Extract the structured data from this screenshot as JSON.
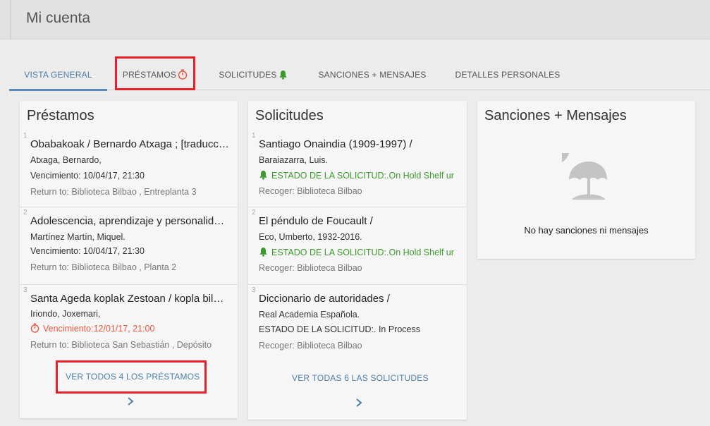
{
  "header": {
    "title": "Mi cuenta"
  },
  "tabs": [
    {
      "label": "VISTA GENERAL"
    },
    {
      "label": "PRÉSTAMOS"
    },
    {
      "label": "SOLICITUDES"
    },
    {
      "label": "SANCIONES + MENSAJES"
    },
    {
      "label": "DETALLES PERSONALES"
    }
  ],
  "loans": {
    "title": "Préstamos",
    "items": [
      {
        "num": "1",
        "title": "Obabakoak / Bernardo Atxaga ; [traducción...",
        "author": "Atxaga, Bernardo,",
        "due": "Vencimiento: 10/04/17, 21:30",
        "return_to": "Return to: Biblioteca Bilbao , Entreplanta 3"
      },
      {
        "num": "2",
        "title": "Adolescencia, aprendizaje y personalidad...",
        "author": "Martínez Martín, Miquel.",
        "due": "Vencimiento: 10/04/17, 21:30",
        "return_to": "Return to: Biblioteca Bilbao , Planta 2"
      },
      {
        "num": "3",
        "title": "Santa Ageda koplak Zestoan / kopla bildumak...",
        "author": "Iriondo, Joxemari,",
        "due": "Vencimiento:12/01/17, 21:00",
        "return_to": "Return to: Biblioteca San Sebastián , Depósito"
      }
    ],
    "see_all": "VER TODOS 4 LOS PRÉSTAMOS"
  },
  "requests": {
    "title": "Solicitudes",
    "items": [
      {
        "num": "1",
        "title": "Santiago Onaindia (1909-1997) /",
        "author": "Baraiazarra, Luis.",
        "status": "ESTADO DE LA SOLICITUD:.On Hold Shelf ur",
        "pickup": "Recoger: Biblioteca Bilbao"
      },
      {
        "num": "2",
        "title": "El péndulo de Foucault /",
        "author": "Eco, Umberto, 1932-2016.",
        "status": "ESTADO DE LA SOLICITUD:.On Hold Shelf ur",
        "pickup": "Recoger: Biblioteca Bilbao"
      },
      {
        "num": "3",
        "title": "Diccionario de autoridades /",
        "author": "Real Academia Española.",
        "status": "ESTADO DE LA SOLICITUD:. In Process",
        "pickup": "Recoger: Biblioteca Bilbao"
      }
    ],
    "see_all": "VER TODAS 6 LAS SOLICITUDES"
  },
  "fines": {
    "title": "Sanciones + Mensajes",
    "empty_text": "No hay sanciones ni mensajes",
    "icon": "beach-umbrella-icon"
  },
  "colors": {
    "accent": "#4d7fa8",
    "overdue": "#e8573f",
    "on_hold": "#3b9a2a",
    "highlight": "#e8202b"
  }
}
